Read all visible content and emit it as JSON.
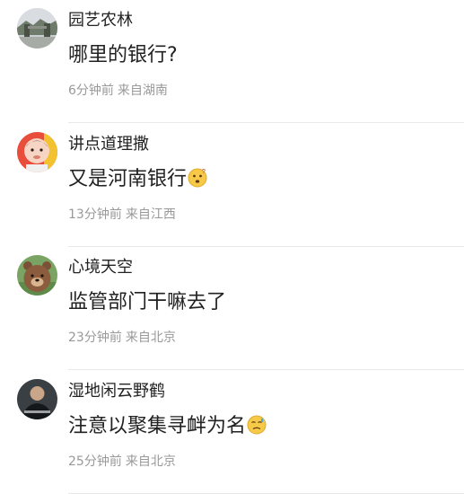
{
  "comments": [
    {
      "username": "园艺农林",
      "content": "哪里的银行?",
      "time": "6分钟前",
      "location": "来自湖南",
      "emoji": ""
    },
    {
      "username": "讲点道理撒",
      "content": "又是河南银行",
      "time": "13分钟前",
      "location": "来自江西",
      "emoji": "thinking-face-emoji"
    },
    {
      "username": "心境天空",
      "content": "监管部门干嘛去了",
      "time": "23分钟前",
      "location": "来自北京",
      "emoji": ""
    },
    {
      "username": "湿地闲云野鹤",
      "content": "注意以聚集寻衅为名",
      "time": "25分钟前",
      "location": "来自北京",
      "emoji": "anxious-sweat-face-emoji"
    }
  ],
  "colors": {
    "text": "#222222",
    "meta": "#999999",
    "divider": "#e8e8e8",
    "emoji": "#f7c948"
  }
}
